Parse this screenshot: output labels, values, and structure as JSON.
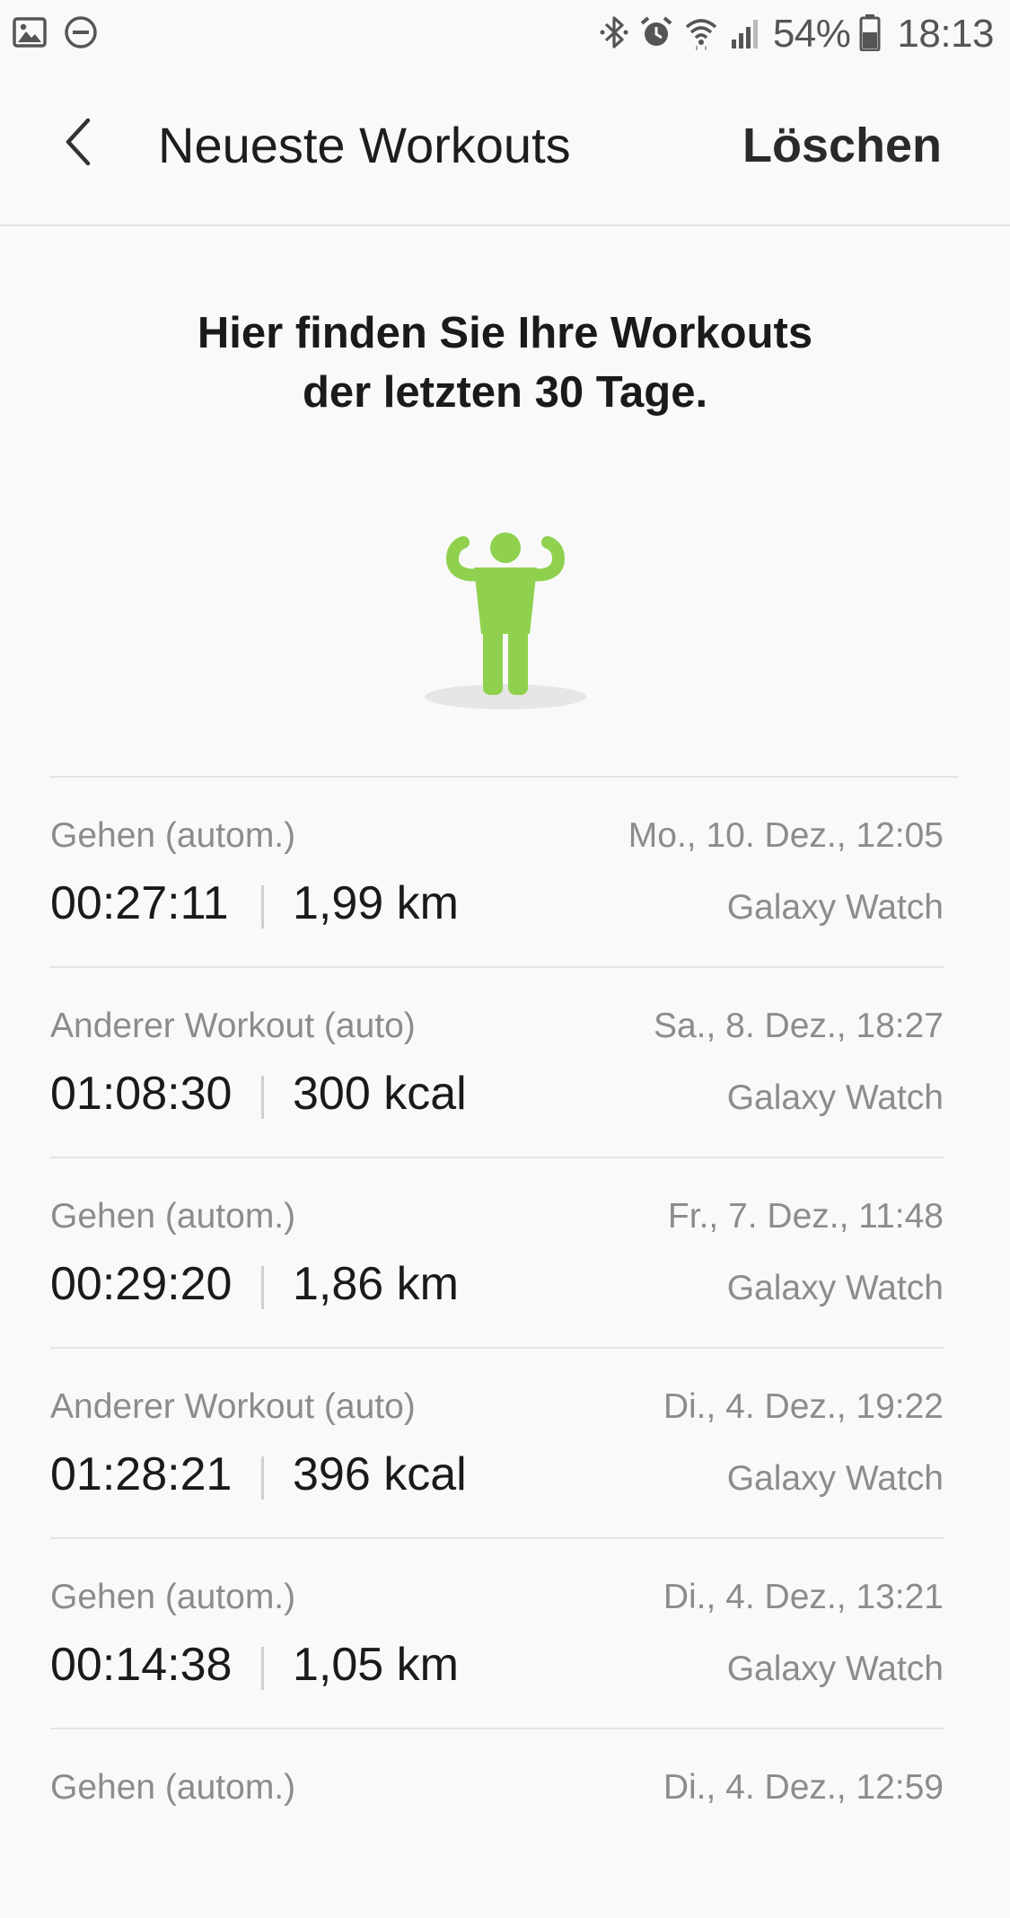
{
  "status_bar": {
    "battery_percent": "54%",
    "time": "18:13",
    "left_icons": [
      "image-icon",
      "dnd-icon"
    ],
    "right_icons": [
      "bluetooth-icon",
      "alarm-icon",
      "wifi-icon",
      "signal-icon",
      "battery-icon"
    ]
  },
  "header": {
    "title": "Neueste Workouts",
    "action_label": "Löschen"
  },
  "intro": {
    "text": "Hier finden Sie Ihre Workouts der letzten 30 Tage.",
    "illustration": "person-flexing-icon",
    "illustration_color": "#8fd14f"
  },
  "workouts": [
    {
      "type": "Gehen (autom.)",
      "date": "Mo., 10. Dez., 12:05",
      "duration": "00:27:11",
      "metric": "1,99 km",
      "device": "Galaxy Watch"
    },
    {
      "type": "Anderer Workout (auto)",
      "date": "Sa., 8. Dez., 18:27",
      "duration": "01:08:30",
      "metric": "300 kcal",
      "device": "Galaxy Watch"
    },
    {
      "type": "Gehen (autom.)",
      "date": "Fr., 7. Dez., 11:48",
      "duration": "00:29:20",
      "metric": "1,86 km",
      "device": "Galaxy Watch"
    },
    {
      "type": "Anderer Workout (auto)",
      "date": "Di., 4. Dez., 19:22",
      "duration": "01:28:21",
      "metric": "396 kcal",
      "device": "Galaxy Watch"
    },
    {
      "type": "Gehen (autom.)",
      "date": "Di., 4. Dez., 13:21",
      "duration": "00:14:38",
      "metric": "1,05 km",
      "device": "Galaxy Watch"
    },
    {
      "type": "Gehen (autom.)",
      "date": "Di., 4. Dez., 12:59",
      "duration": "",
      "metric": "",
      "device": ""
    }
  ],
  "colors": {
    "background": "#f9f9f9",
    "primary_text": "#1a1a1a",
    "secondary_text": "#8c8c8c",
    "divider": "#e3e3e3",
    "accent_green": "#8fd14f"
  }
}
